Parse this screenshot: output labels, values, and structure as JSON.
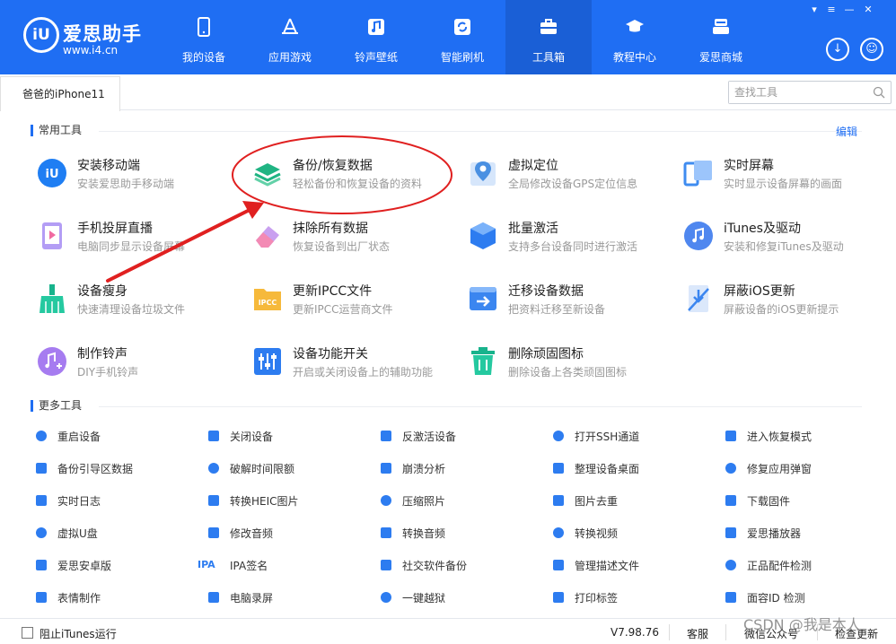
{
  "app": {
    "brand": "爱思助手",
    "url": "www.i4.cn",
    "logo_glyph": "iU"
  },
  "nav": [
    {
      "label": "我的设备",
      "icon": "phone-icon"
    },
    {
      "label": "应用游戏",
      "icon": "app-store-icon"
    },
    {
      "label": "铃声壁纸",
      "icon": "music-note-icon"
    },
    {
      "label": "智能刷机",
      "icon": "refresh-icon"
    },
    {
      "label": "工具箱",
      "icon": "toolbox-icon",
      "active": true
    },
    {
      "label": "教程中心",
      "icon": "graduation-cap-icon"
    },
    {
      "label": "爱思商城",
      "icon": "store-icon"
    }
  ],
  "device_tab": "爸爸的iPhone11",
  "search": {
    "placeholder": "查找工具"
  },
  "common": {
    "title": "常用工具",
    "edit": "编辑",
    "tools": [
      {
        "name": "安装移动端",
        "desc": "安装爱思助手移动端",
        "icon": "i4-app-icon"
      },
      {
        "name": "备份/恢复数据",
        "desc": "轻松备份和恢复设备的资料",
        "icon": "layers-icon"
      },
      {
        "name": "虚拟定位",
        "desc": "全局修改设备GPS定位信息",
        "icon": "map-pin-icon"
      },
      {
        "name": "实时屏幕",
        "desc": "实时显示设备屏幕的画面",
        "icon": "screen-mirror-icon"
      },
      {
        "name": "手机投屏直播",
        "desc": "电脑同步显示设备屏幕",
        "icon": "cast-play-icon"
      },
      {
        "name": "抹除所有数据",
        "desc": "恢复设备到出厂状态",
        "icon": "eraser-icon"
      },
      {
        "name": "批量激活",
        "desc": "支持多台设备同时进行激活",
        "icon": "hexagon-icon"
      },
      {
        "name": "iTunes及驱动",
        "desc": "安装和修复iTunes及驱动",
        "icon": "itunes-icon"
      },
      {
        "name": "设备瘦身",
        "desc": "快速清理设备垃圾文件",
        "icon": "broom-icon"
      },
      {
        "name": "更新IPCC文件",
        "desc": "更新IPCC运营商文件",
        "icon": "ipcc-folder-icon"
      },
      {
        "name": "迁移设备数据",
        "desc": "把资料迁移至新设备",
        "icon": "transfer-icon"
      },
      {
        "name": "屏蔽iOS更新",
        "desc": "屏蔽设备的iOS更新提示",
        "icon": "block-update-icon"
      },
      {
        "name": "制作铃声",
        "desc": "DIY手机铃声",
        "icon": "ringtone-icon"
      },
      {
        "name": "设备功能开关",
        "desc": "开启或关闭设备上的辅助功能",
        "icon": "sliders-icon"
      },
      {
        "name": "删除顽固图标",
        "desc": "删除设备上各类顽固图标",
        "icon": "trash-icon"
      }
    ]
  },
  "more": {
    "title": "更多工具",
    "tools": [
      {
        "name": "重启设备",
        "icon": "restart-icon"
      },
      {
        "name": "关闭设备",
        "icon": "power-icon"
      },
      {
        "name": "反激活设备",
        "icon": "deactivate-icon"
      },
      {
        "name": "打开SSH通道",
        "icon": "terminal-icon"
      },
      {
        "name": "进入恢复模式",
        "icon": "recovery-mode-icon"
      },
      {
        "name": "备份引导区数据",
        "icon": "backup-boot-icon"
      },
      {
        "name": "破解时间限额",
        "icon": "clock-icon"
      },
      {
        "name": "崩溃分析",
        "icon": "crash-analysis-icon"
      },
      {
        "name": "整理设备桌面",
        "icon": "grid-icon"
      },
      {
        "name": "修复应用弹窗",
        "icon": "fix-popup-icon"
      },
      {
        "name": "实时日志",
        "icon": "log-icon"
      },
      {
        "name": "转换HEIC图片",
        "icon": "heic-convert-icon"
      },
      {
        "name": "压缩照片",
        "icon": "image-compress-icon"
      },
      {
        "name": "图片去重",
        "icon": "image-dedupe-icon"
      },
      {
        "name": "下载固件",
        "icon": "firmware-icon"
      },
      {
        "name": "虚拟U盘",
        "icon": "usb-drive-icon"
      },
      {
        "name": "修改音频",
        "icon": "audio-file-icon"
      },
      {
        "name": "转换音频",
        "icon": "audio-convert-icon"
      },
      {
        "name": "转换视频",
        "icon": "video-convert-icon"
      },
      {
        "name": "爱思播放器",
        "icon": "player-icon"
      },
      {
        "name": "爱思安卓版",
        "icon": "i4-android-icon"
      },
      {
        "name": "IPA签名",
        "icon": "ipa-text-icon",
        "glyph": "IPA"
      },
      {
        "name": "社交软件备份",
        "icon": "chat-backup-icon"
      },
      {
        "name": "管理描述文件",
        "icon": "profile-icon"
      },
      {
        "name": "正品配件检测",
        "icon": "accessory-icon"
      },
      {
        "name": "表情制作",
        "icon": "emoji-icon"
      },
      {
        "name": "电脑录屏",
        "icon": "record-icon"
      },
      {
        "name": "一键越狱",
        "icon": "unlock-icon"
      },
      {
        "name": "打印标签",
        "icon": "printer-icon"
      },
      {
        "name": "面容ID 检测",
        "icon": "face-id-icon"
      }
    ]
  },
  "status": {
    "block_itunes": "阻止iTunes运行",
    "version": "V7.98.76",
    "service": "客服",
    "wechat": "微信公众号",
    "check_update": "检查更新"
  },
  "watermark": "CSDN @我是本人",
  "colors": {
    "header": "#1f6ef3",
    "accent": "#1f6ef3",
    "annotation": "#e02020"
  }
}
